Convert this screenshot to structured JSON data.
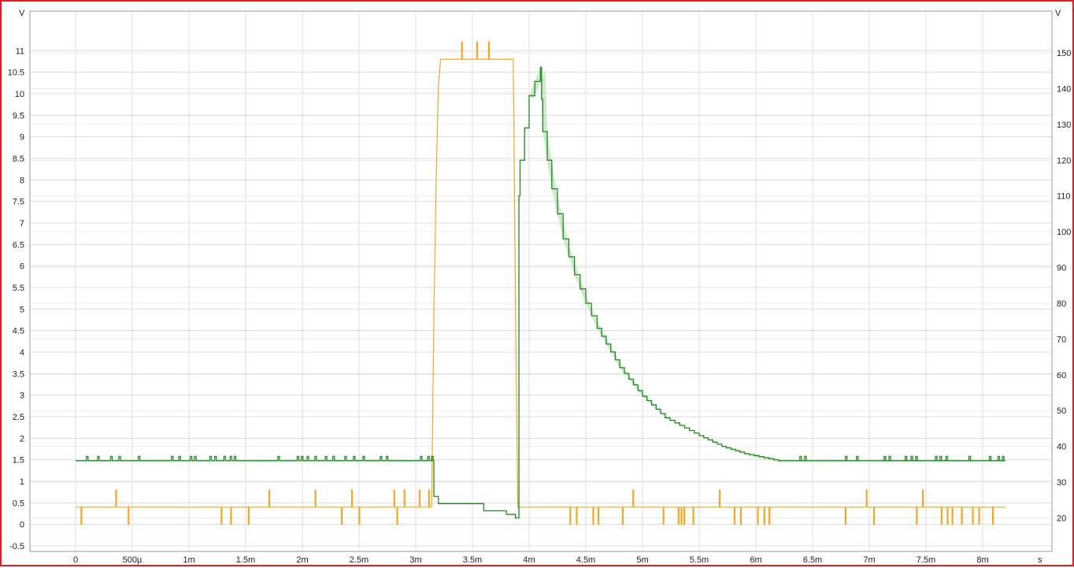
{
  "chart_data": {
    "type": "line",
    "title": "",
    "xlabel": "",
    "x_unit": "s",
    "y_left_unit": "V",
    "y_right_unit": "V",
    "grid": true,
    "legend": "none",
    "xlim": [
      0,
      0.0085
    ],
    "ylim_left": [
      -0.5,
      11.5
    ],
    "ylim_right": [
      15,
      155
    ],
    "x_ticks": [
      0,
      0.0005,
      0.001,
      0.0015,
      0.002,
      0.0025,
      0.003,
      0.0035,
      0.004,
      0.0045,
      0.005,
      0.0055,
      0.006,
      0.0065,
      0.007,
      0.0075,
      0.008
    ],
    "x_tick_labels": [
      "0",
      "500µ",
      "1m",
      "1.5m",
      "2m",
      "2.5m",
      "3m",
      "3.5m",
      "4m",
      "4.5m",
      "5m",
      "5.5m",
      "6m",
      "6.5m",
      "7m",
      "7.5m",
      "8m"
    ],
    "y_left_ticks": [
      -0.5,
      0,
      0.5,
      1,
      1.5,
      2,
      2.5,
      3,
      3.5,
      4,
      4.5,
      5,
      5.5,
      6,
      6.5,
      7,
      7.5,
      8,
      8.5,
      9,
      9.5,
      10,
      10.5,
      11
    ],
    "y_left_tick_labels": [
      "-0.5",
      "0",
      "0.5",
      "1",
      "1.5",
      "2",
      "2.5",
      "3",
      "3.5",
      "4",
      "4.5",
      "5",
      "5.5",
      "6",
      "6.5",
      "7",
      "7.5",
      "8",
      "8.5",
      "9",
      "9.5",
      "10",
      "10.5",
      "11"
    ],
    "y_right_ticks": [
      20,
      30,
      40,
      50,
      60,
      70,
      80,
      90,
      100,
      110,
      120,
      130,
      140,
      150
    ],
    "y_right_tick_labels": [
      "20",
      "30",
      "40",
      "50",
      "60",
      "70",
      "80",
      "90",
      "100",
      "110",
      "120",
      "130",
      "140",
      "150"
    ],
    "colors": {
      "orange": "#f5a623",
      "green": "#1e8a1e",
      "green_fill": "#bfe3bf"
    },
    "series": [
      {
        "axis": "left",
        "color": "#f5a623",
        "noise": {
          "base": 0.4,
          "low": 0.0,
          "high": 0.8
        },
        "x": [
          0,
          0.00314,
          0.00316,
          0.00318,
          0.0032,
          0.00322,
          0.0035,
          0.0038,
          0.00386,
          0.00388,
          0.0039,
          0.00392,
          0.0082
        ],
        "y": [
          0.4,
          0.4,
          4.8,
          8.0,
          10.2,
          10.8,
          10.8,
          10.8,
          10.8,
          5.0,
          0.4,
          0.4,
          0.4
        ]
      },
      {
        "axis": "right",
        "color": "#1e8a1e",
        "x": [
          0,
          0.00314,
          0.00316,
          0.0032,
          0.0035,
          0.0036,
          0.0038,
          0.00388,
          0.00391,
          0.00392,
          0.004,
          0.0041,
          0.00412,
          0.0042,
          0.0043,
          0.0044,
          0.0045,
          0.0046,
          0.0048,
          0.005,
          0.0052,
          0.0055,
          0.0057,
          0.0059,
          0.0062,
          0.0065,
          0.0082
        ],
        "y": [
          36,
          36,
          26,
          24,
          24,
          22,
          21,
          20,
          110,
          120,
          138,
          146,
          128,
          112,
          98,
          88,
          80,
          73,
          62,
          54,
          48,
          43,
          40,
          38,
          36,
          36,
          36
        ]
      }
    ]
  }
}
